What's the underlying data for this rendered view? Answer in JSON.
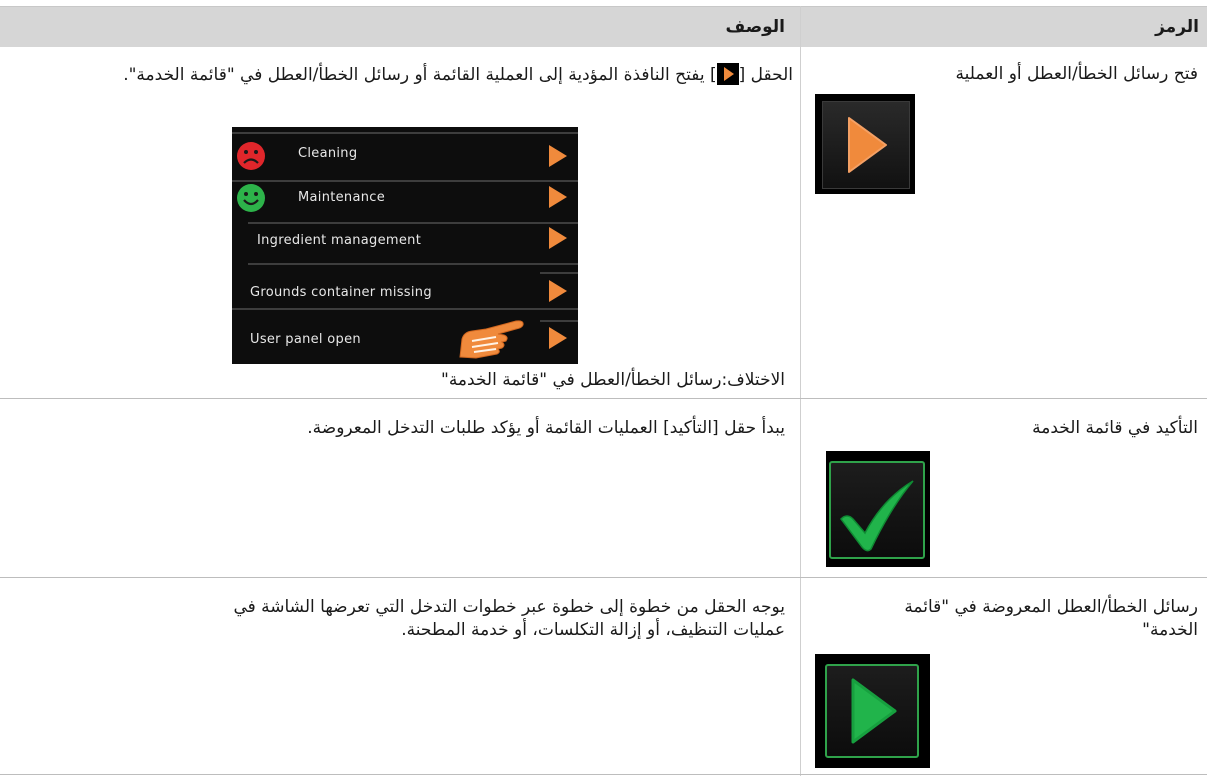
{
  "header": {
    "symbol_label": "الرمز",
    "description_label": "الوصف"
  },
  "rows": [
    {
      "symbol_text": "فتح رسائل الخطأ/العطل أو العملية",
      "icon": "orange-play-icon",
      "description_before": "الحقل [",
      "description_after": "] يفتح النافذة المؤدية إلى العملية القائمة أو رسائل الخطأ/العطل في \"قائمة الخدمة\".",
      "caption": "الاختلاف:رسائل الخطأ/العطل في \"قائمة الخدمة\""
    },
    {
      "symbol_text": "التأكيد في قائمة الخدمة",
      "icon": "green-check-icon",
      "description": "يبدأ حقل [التأكيد] العمليات القائمة أو يؤكد طلبات التدخل المعروضة."
    },
    {
      "symbol_text_line1": "رسائل الخطأ/العطل المعروضة في \"قائمة",
      "symbol_text_line2": "الخدمة\"",
      "icon": "green-play-icon",
      "description_line1": "يوجه الحقل من خطوة إلى خطوة عبر خطوات التدخل التي تعرضها الشاشة في",
      "description_line2": "عمليات التنظيف، أو إزالة التكلسات، أو خدمة المطحنة."
    }
  ],
  "service_panel": {
    "items": [
      {
        "label": "Cleaning",
        "status": "sad-face-icon",
        "status_color": "#e0262b"
      },
      {
        "label": "Maintenance",
        "status": "happy-face-icon",
        "status_color": "#2db34a"
      },
      {
        "label": "Ingredient management"
      },
      {
        "label": "Grounds container missing"
      },
      {
        "label": "User panel open"
      }
    ],
    "arrow_color": "#f08a3c",
    "pointer": "pointing-hand-icon"
  }
}
